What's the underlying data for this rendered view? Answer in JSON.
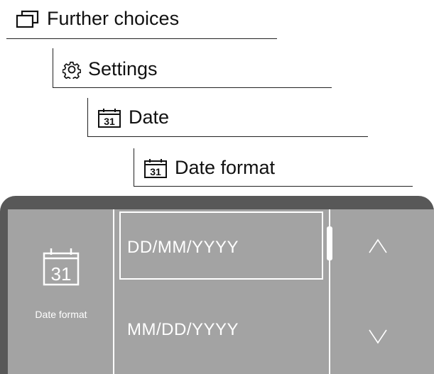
{
  "breadcrumbs": [
    {
      "label": "Further choices",
      "icon": "windows-icon"
    },
    {
      "label": "Settings",
      "icon": "gear-icon"
    },
    {
      "label": "Date",
      "icon": "calendar-31-icon"
    },
    {
      "label": "Date format",
      "icon": "calendar-31-icon"
    }
  ],
  "screen": {
    "calendar_day": "31",
    "caption": "Date format",
    "options": [
      "DD/MM/YYYY",
      "MM/DD/YYYY"
    ],
    "selected_option": "DD/MM/YYYY",
    "up_icon": "chevron-up-icon",
    "down_icon": "chevron-down-icon"
  },
  "colors": {
    "bezel": "#585858",
    "panel": "#a3a3a3",
    "panel_text": "#ffffff"
  }
}
